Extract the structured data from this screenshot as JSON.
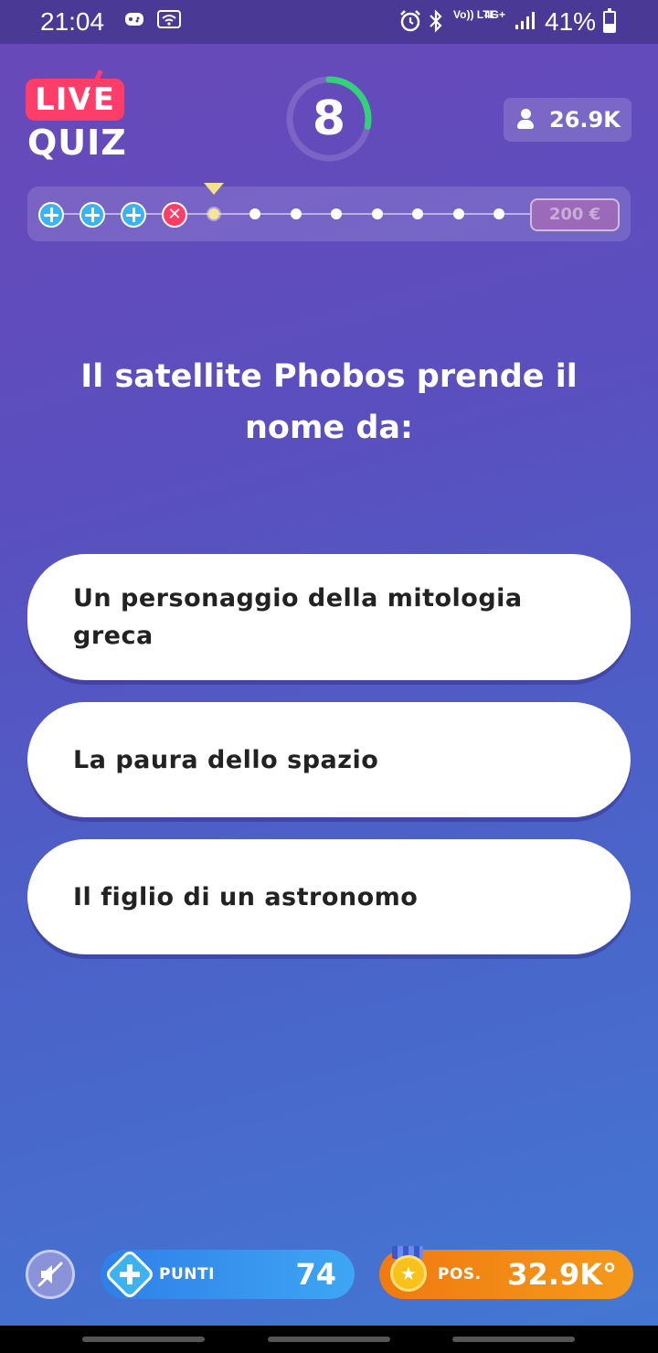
{
  "status_bar": {
    "time": "21:04",
    "left_icons": [
      "game-icon",
      "wifi-icon"
    ],
    "right_icons": [
      "alarm-icon",
      "bluetooth-icon",
      "volte-icon",
      "4g-icon",
      "signal-icon"
    ],
    "volte_text": "Vo)) LTE",
    "network_text": "4G+",
    "battery": "41%",
    "battery_level": 0.41
  },
  "header": {
    "logo_live": "LIVE",
    "logo_quiz": "QUIZ",
    "timer": "8",
    "timer_fraction_remaining": 0.28,
    "viewers": "26.9K"
  },
  "progress": {
    "lives": [
      "plus",
      "plus",
      "plus",
      "cross"
    ],
    "steps_remaining": 8,
    "prize": "200 €"
  },
  "question": {
    "text": "Il satellite Phobos prende il nome da:"
  },
  "answers": [
    {
      "text": "Un personaggio della mitologia greca"
    },
    {
      "text": "La paura dello spazio"
    },
    {
      "text": "Il figlio di un astronomo"
    }
  ],
  "footer": {
    "points_label": "PUNTI",
    "points_value": "74",
    "position_label": "POS.",
    "position_value": "32.9K°"
  },
  "colors": {
    "accent_live": "#ff3d68",
    "timer_ring": "#33d17a",
    "points": "#3ea6f4",
    "position": "#f08a14"
  }
}
